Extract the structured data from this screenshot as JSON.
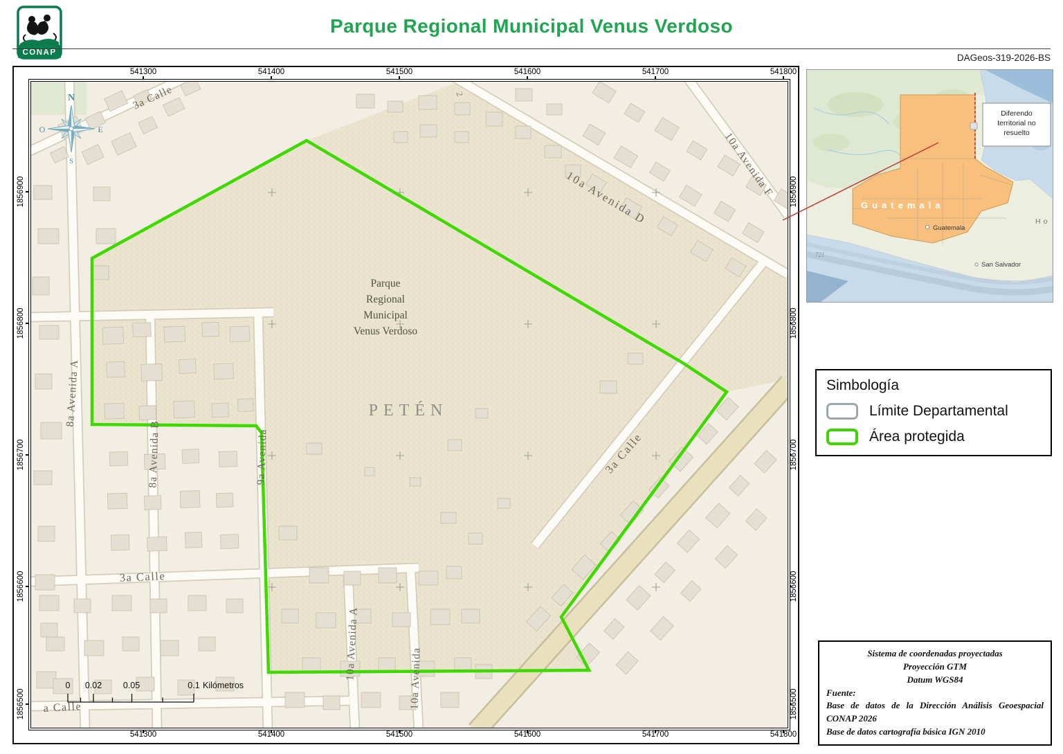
{
  "header": {
    "logo": "CONAP",
    "title": "Parque Regional Municipal Venus Verdoso",
    "doc_id": "DAGeos-319-2026-BS"
  },
  "map": {
    "x_ticks": [
      "541300",
      "541400",
      "541500",
      "541600",
      "541700",
      "541800"
    ],
    "y_ticks": [
      "1856900",
      "1856800",
      "1856700",
      "1856600",
      "1856500"
    ],
    "compass": {
      "n": "N",
      "e": "E",
      "s": "S",
      "o": "O"
    },
    "department": "PETÉN",
    "park_label": {
      "l1": "Parque",
      "l2": "Regional",
      "l3": "Municipal",
      "l4": "Venus Verdoso"
    },
    "streets": {
      "calle3_nw": "3a Calle",
      "calle3_mid": "3a Calle",
      "calle3_e": "3a Calle",
      "calle_partial": "a Calle",
      "num_partial": "2",
      "av8a": "8a Avenida A",
      "av8b": "8a Avenida B",
      "av9": "9a Avenida",
      "av10a": "10a Avenida A",
      "av10": "10a Avenida",
      "av10d": "10a Avenida D",
      "av10f": "10a Avenida F"
    },
    "scalebar": {
      "t0": "0",
      "t1": "0.02",
      "t2": "0.05",
      "t3": "0.1",
      "unit": "Kilómetros"
    }
  },
  "inset": {
    "note_l1": "Diferendo",
    "note_l2": "territorial no",
    "note_l3": "resuelto",
    "country": "Guatemala",
    "city": "Guatemala",
    "neighbor_city": "San Salvador",
    "depth": "721",
    "honduras_partial": "Ho"
  },
  "legend": {
    "title": "Simbología",
    "item1": "Límite Departamental",
    "item2": "Área protegida"
  },
  "credits": {
    "l1": "Sistema de coordenadas proyectadas",
    "l2": "Proyección GTM",
    "l3": "Datum WGS84",
    "l4": "Fuente:",
    "l5": "Base de datos de la Dirección Análisis Geoespacial CONAP 2026",
    "l6": "Base de datos cartografía básica IGN 2010"
  },
  "colors": {
    "title_green": "#21a551",
    "protected_green": "#3fd400",
    "limite_gray": "#a0a6ad",
    "guatemala_orange": "#f8c07c"
  }
}
